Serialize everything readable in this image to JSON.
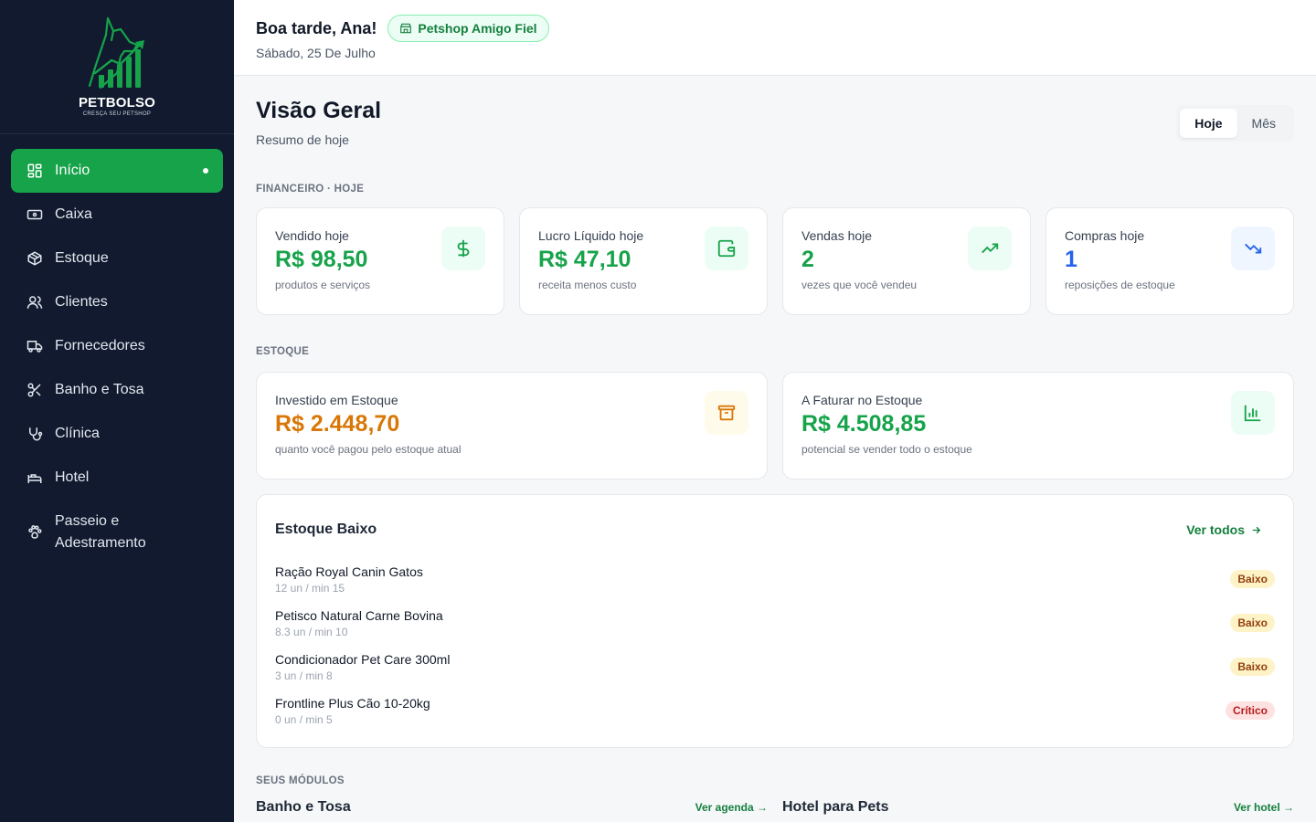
{
  "brand": {
    "name": "PETBOLSO",
    "tagline": "CRESÇA SEU PETSHOP"
  },
  "sidebar": {
    "items": [
      {
        "label": "Início",
        "icon": "dashboard-icon",
        "active": true
      },
      {
        "label": "Caixa",
        "icon": "cash-icon"
      },
      {
        "label": "Estoque",
        "icon": "box-icon"
      },
      {
        "label": "Clientes",
        "icon": "users-icon"
      },
      {
        "label": "Fornecedores",
        "icon": "truck-icon"
      },
      {
        "label": "Banho e Tosa",
        "icon": "scissors-icon"
      },
      {
        "label": "Clínica",
        "icon": "stethoscope-icon"
      },
      {
        "label": "Hotel",
        "icon": "bed-icon"
      },
      {
        "label": "Passeio e Adestramento",
        "icon": "paw-icon"
      }
    ]
  },
  "header": {
    "greeting": "Boa tarde, Ana!",
    "shop": "Petshop Amigo Fiel",
    "date": "Sábado, 25 De Julho"
  },
  "overview": {
    "title": "Visão Geral",
    "subtitle": "Resumo de hoje",
    "toggle": {
      "today": "Hoje",
      "month": "Mês",
      "selected": "Hoje"
    }
  },
  "financial": {
    "section": "FINANCEIRO · HOJE",
    "cards": [
      {
        "label": "Vendido hoje",
        "value": "R$ 98,50",
        "note": "produtos e serviços",
        "icon": "dollar-icon",
        "color": "#16a34a"
      },
      {
        "label": "Lucro Líquido hoje",
        "value": "R$ 47,10",
        "note": "receita menos custo",
        "icon": "wallet-icon",
        "color": "#16a34a"
      },
      {
        "label": "Vendas hoje",
        "value": "2",
        "note": "vezes que você vendeu",
        "icon": "trending-up-icon",
        "color": "#16a34a"
      },
      {
        "label": "Compras hoje",
        "value": "1",
        "note": "reposições de estoque",
        "icon": "trending-down-icon",
        "color": "#2563eb"
      }
    ]
  },
  "stock": {
    "section": "ESTOQUE",
    "cards": [
      {
        "label": "Investido em Estoque",
        "value": "R$ 2.448,70",
        "note": "quanto você pagou pelo estoque atual",
        "icon": "archive-icon",
        "color": "#d97706"
      },
      {
        "label": "A Faturar no Estoque",
        "value": "R$ 4.508,85",
        "note": "potencial se vender todo o estoque",
        "icon": "bar-chart-icon",
        "color": "#16a34a"
      }
    ]
  },
  "low_stock": {
    "title": "Estoque Baixo",
    "see_all": "Ver todos",
    "items": [
      {
        "name": "Ração Royal Canin Gatos",
        "qty": "12 un / min 15",
        "status": "Baixo"
      },
      {
        "name": "Petisco Natural Carne Bovina",
        "qty": "8.3 un / min 10",
        "status": "Baixo"
      },
      {
        "name": "Condicionador Pet Care 300ml",
        "qty": "3 un / min 8",
        "status": "Baixo"
      },
      {
        "name": "Frontline Plus Cão 10-20kg",
        "qty": "0 un / min 5",
        "status": "Crítico"
      }
    ]
  },
  "modules": {
    "section": "SEUS MÓDULOS",
    "items": [
      {
        "title": "Banho e Tosa",
        "link": "Ver agenda →"
      },
      {
        "title": "Hotel para Pets",
        "link": "Ver hotel →"
      }
    ]
  }
}
